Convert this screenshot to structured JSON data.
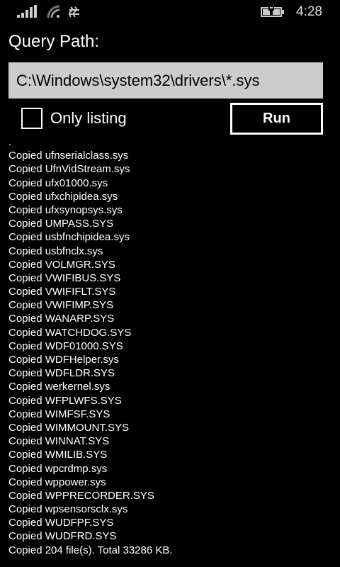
{
  "status_bar": {
    "time": "4:28",
    "icons": [
      "signal-icon",
      "wifi-icon",
      "vibrate-icon",
      "battery-charging-icon"
    ]
  },
  "query": {
    "label": "Query Path:",
    "value": "C:\\Windows\\system32\\drivers\\*.sys"
  },
  "only_listing": {
    "label": "Only listing",
    "checked": false
  },
  "run_label": "Run",
  "log": [
    ".",
    "Copied ufnserialclass.sys",
    "Copied UfnVidStream.sys",
    "Copied ufx01000.sys",
    "Copied ufxchipidea.sys",
    "Copied ufxsynopsys.sys",
    "Copied UMPASS.SYS",
    "Copied usbfnchipidea.sys",
    "Copied usbfnclx.sys",
    "Copied VOLMGR.SYS",
    "Copied VWIFIBUS.SYS",
    "Copied VWIFIFLT.SYS",
    "Copied VWIFIMP.SYS",
    "Copied WANARP.SYS",
    "Copied WATCHDOG.SYS",
    "Copied WDF01000.SYS",
    "Copied WDFHelper.sys",
    "Copied WDFLDR.SYS",
    "Copied werkernel.sys",
    "Copied WFPLWFS.SYS",
    "Copied WIMFSF.SYS",
    "Copied WIMMOUNT.SYS",
    "Copied WINNAT.SYS",
    "Copied WMILIB.SYS",
    "Copied wpcrdmp.sys",
    "Copied wppower.sys",
    "Copied WPPRECORDER.SYS",
    "Copied wpsensorsclx.sys",
    "Copied WUDFPF.SYS",
    "Copied WUDFRD.SYS",
    "Copied 204 file(s). Total 33286 KB."
  ]
}
